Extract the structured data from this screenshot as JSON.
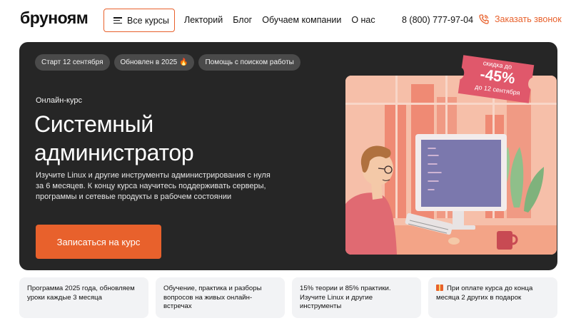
{
  "header": {
    "logo": "бруноям",
    "all_courses": "Все курсы",
    "nav": [
      "Лекторий",
      "Блог",
      "Обучаем компании",
      "О нас"
    ],
    "phone": "8 (800) 777-97-04",
    "callback": "Заказать звонок"
  },
  "hero": {
    "tags": [
      "Старт 12 сентября",
      "Обновлен в 2025 🔥",
      "Помощь с поиском работы"
    ],
    "kind": "Онлайн-курс",
    "title": "Системный администратор",
    "description": "Изучите Linux и другие инструменты администрирования с нуля за 6 месяцев. К концу курса научитесь поддерживать серверы, программы и сетевые продукты в рабочем состоянии",
    "cta": "Записаться на курс",
    "discount": {
      "label": "скидка до",
      "value": "-45%",
      "until": "до 12 сентября"
    }
  },
  "features": [
    "Программа 2025 года, обновляем уроки каждые 3 месяца",
    "Обучение, практика и разборы вопросов на живых онлайн-встречах",
    "15% теории и 85% практики. Изучите Linux и другие инструменты",
    "При оплате курса до конца месяца 2 других в подарок"
  ],
  "colors": {
    "accent": "#e8612c",
    "hero_bg": "#262626",
    "tag_bg": "#4a4a4a",
    "card_bg": "#f2f3f5",
    "discount_bg": "#e0586b"
  },
  "icons": [
    "burger-menu-icon",
    "phone-icon",
    "gift-icon"
  ]
}
